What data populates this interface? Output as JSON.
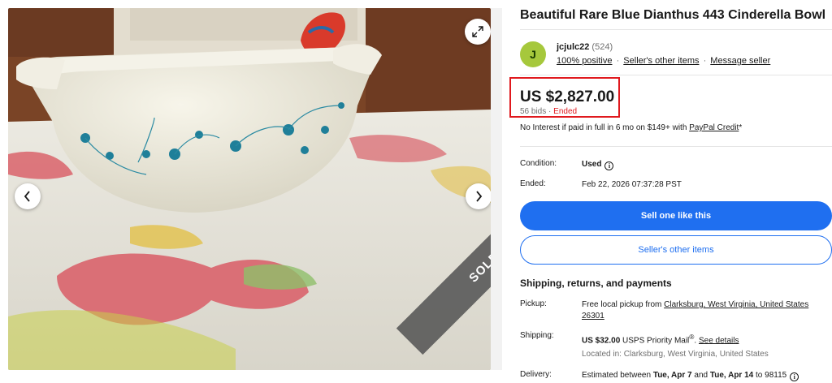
{
  "colors": {
    "accent": "#1f6ff0",
    "price_highlight": "#e0191e",
    "ended": "#e0191e",
    "avatar_bg": "#a6c83c"
  },
  "gallery": {
    "prev_icon": "chevron-left-icon",
    "next_icon": "chevron-right-icon",
    "expand_icon": "expand-icon",
    "sold_label": "SOLD"
  },
  "listing": {
    "title": "Beautiful Rare Blue Dianthus 443 Cinderella Bowl"
  },
  "seller": {
    "avatar_letter": "J",
    "name": "jcjulc22",
    "feedback_count": "(524)",
    "positive": "100% positive",
    "other_items": "Seller's other items",
    "message": "Message seller",
    "separator": "·"
  },
  "pricing": {
    "price": "US $2,827.00",
    "bids": "56 bids",
    "separator": "·",
    "status": "Ended",
    "finance_text": "No Interest if paid in full in 6 mo on $149+ with ",
    "finance_link": "PayPal Credit",
    "finance_suffix": "*"
  },
  "details": {
    "condition_label": "Condition:",
    "condition_value": "Used",
    "ended_label": "Ended:",
    "ended_value": "Feb 22, 2026 07:37:28 PST"
  },
  "actions": {
    "sell_one": "Sell one like this",
    "other_items": "Seller's other items"
  },
  "shipping": {
    "heading": "Shipping, returns, and payments",
    "pickup_label": "Pickup:",
    "pickup_text": "Free local pickup from ",
    "pickup_location": "Clarksburg, West Virginia, United States 26301",
    "shipping_label": "Shipping:",
    "shipping_price": "US $32.00",
    "shipping_service": " USPS Priority Mail",
    "shipping_reg": "®",
    "shipping_sep": ". ",
    "see_details": "See details",
    "located_in": "Located in: Clarksburg, West Virginia, United States",
    "delivery_label": "Delivery:",
    "delivery_prefix": "Estimated between ",
    "delivery_start": "Tue, Apr 7",
    "delivery_and": " and ",
    "delivery_end": "Tue, Apr 14",
    "delivery_suffix": " to 98115"
  }
}
